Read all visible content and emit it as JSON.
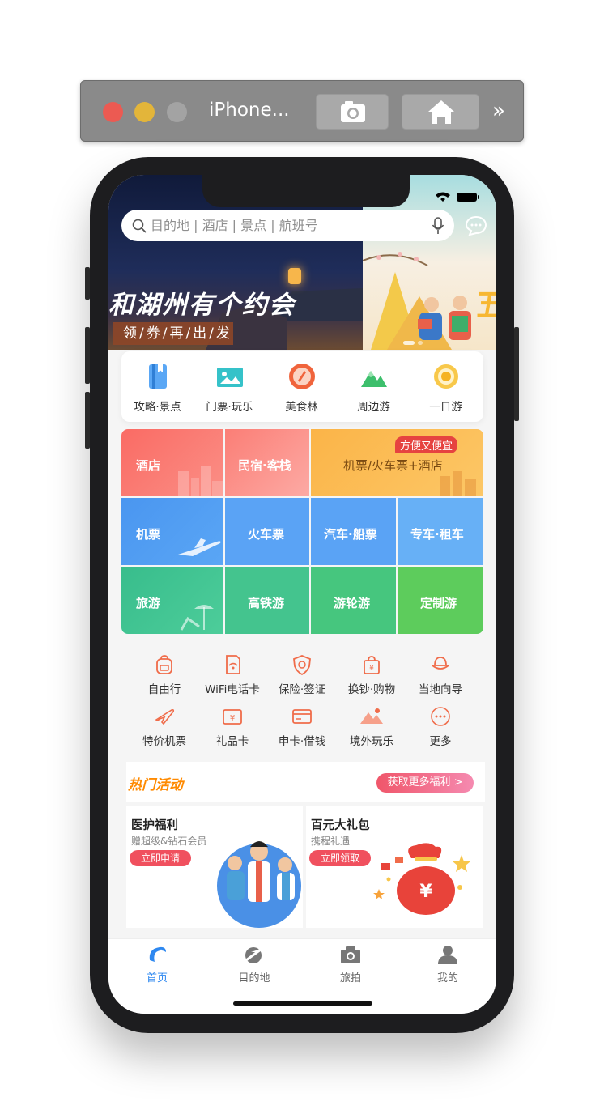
{
  "simulator": {
    "title": "iPhone...",
    "more_label": "»"
  },
  "search": {
    "placeholder": "目的地 | 酒店 | 景点 | 航班号"
  },
  "banner": {
    "title": "和湖州有个约会",
    "tag": "领/券/再/出/发",
    "right_text": "五"
  },
  "quick_nav": [
    {
      "label": "攻略·景点",
      "icon": "guide-book-icon",
      "color": "#3f9af0"
    },
    {
      "label": "门票·玩乐",
      "icon": "ticket-icon",
      "color": "#35c2c9"
    },
    {
      "label": "美食林",
      "icon": "food-icon",
      "color": "#f0643c"
    },
    {
      "label": "周边游",
      "icon": "mountain-icon",
      "color": "#3dbf6c"
    },
    {
      "label": "一日游",
      "icon": "sun-icon",
      "color": "#f5b323"
    }
  ],
  "grid": {
    "hotel": "酒店",
    "homestay": "民宿·客栈",
    "combo": "机票/火车票+酒店",
    "badge": "方便又便宜",
    "flight": "机票",
    "train": "火车票",
    "bus": "汽车·船票",
    "car": "专车·租车",
    "travel": "旅游",
    "rail_tour": "高铁游",
    "cruise": "游轮游",
    "custom": "定制游",
    "colors": {
      "red": "#fa6d68",
      "blue": "#4e9bf2",
      "green": "#3dc18a",
      "orange": "#fbb54a"
    }
  },
  "services": [
    {
      "label": "自由行",
      "icon": "backpack-icon"
    },
    {
      "label": "WiFi电话卡",
      "icon": "wifi-card-icon"
    },
    {
      "label": "保险·签证",
      "icon": "shield-icon"
    },
    {
      "label": "换钞·购物",
      "icon": "shopping-bag-icon"
    },
    {
      "label": "当地向导",
      "icon": "guide-hat-icon"
    },
    {
      "label": "特价机票",
      "icon": "plane-icon"
    },
    {
      "label": "礼品卡",
      "icon": "gift-card-icon"
    },
    {
      "label": "申卡·借钱",
      "icon": "bank-card-icon"
    },
    {
      "label": "境外玩乐",
      "icon": "landscape-icon"
    },
    {
      "label": "更多",
      "icon": "more-icon"
    }
  ],
  "hot": {
    "title": "热门活动",
    "more": "获取更多福利 >"
  },
  "promos": [
    {
      "title": "医护福利",
      "sub": "赠超级&钻石会员",
      "button": "立即申请"
    },
    {
      "title": "百元大礼包",
      "sub": "携程礼遇",
      "button": "立即领取"
    }
  ],
  "tabs": [
    {
      "label": "首页",
      "icon": "dolphin-home-icon",
      "active": true
    },
    {
      "label": "目的地",
      "icon": "globe-plane-icon",
      "active": false
    },
    {
      "label": "旅拍",
      "icon": "camera-icon",
      "active": false
    },
    {
      "label": "我的",
      "icon": "person-icon",
      "active": false
    }
  ],
  "colors": {
    "accent": "#2e88f0",
    "tab_inactive": "#666666"
  }
}
